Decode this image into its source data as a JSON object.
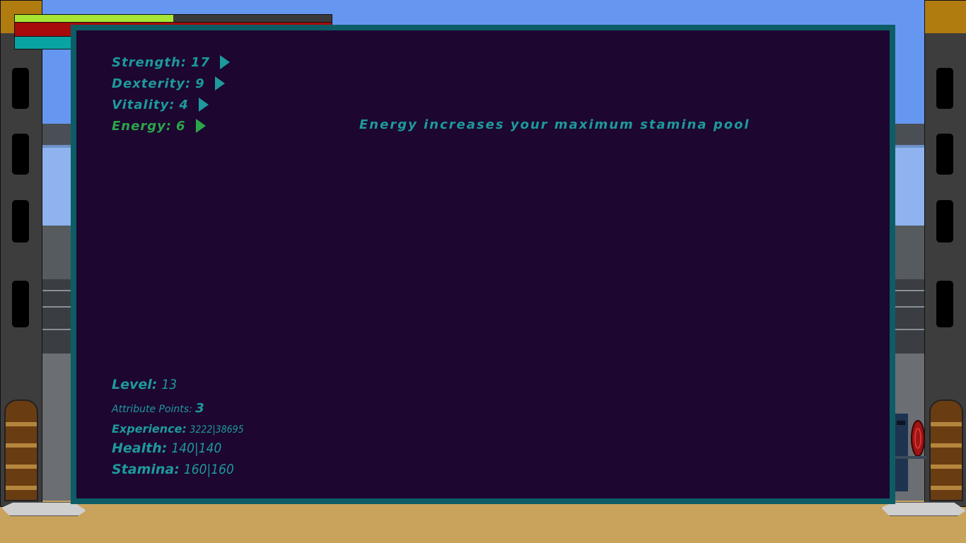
{
  "hud": {
    "bars": [
      {
        "name": "experience-bar",
        "fraction": 0.5,
        "color": "#a6e633"
      },
      {
        "name": "health-bar",
        "fraction": 1.0,
        "color": "#a80b0b"
      },
      {
        "name": "stamina-bar",
        "fraction": 1.0,
        "color": "#0aa3a3"
      }
    ]
  },
  "attributes": [
    {
      "label": "Strength:",
      "value": "17",
      "selected": false
    },
    {
      "label": "Dexterity:",
      "value": "9",
      "selected": false
    },
    {
      "label": "Vitality:",
      "value": "4",
      "selected": false
    },
    {
      "label": "Energy:",
      "value": "6",
      "selected": true
    }
  ],
  "tooltip": "Energy increases your maximum stamina pool",
  "info": {
    "level_label": "Level:",
    "level_value": "13",
    "points_label": "Attribute Points:",
    "points_value": "3",
    "experience_label": "Experience:",
    "experience_value": "3222|38695",
    "health_label": "Health:",
    "health_value": "140|140",
    "stamina_label": "Stamina:",
    "stamina_value": "160|160"
  },
  "colors": {
    "panel_bg": "#1d0630",
    "panel_border": "#0d5d66",
    "text": "#1d9a9b",
    "selected_text": "#2aa64a"
  }
}
